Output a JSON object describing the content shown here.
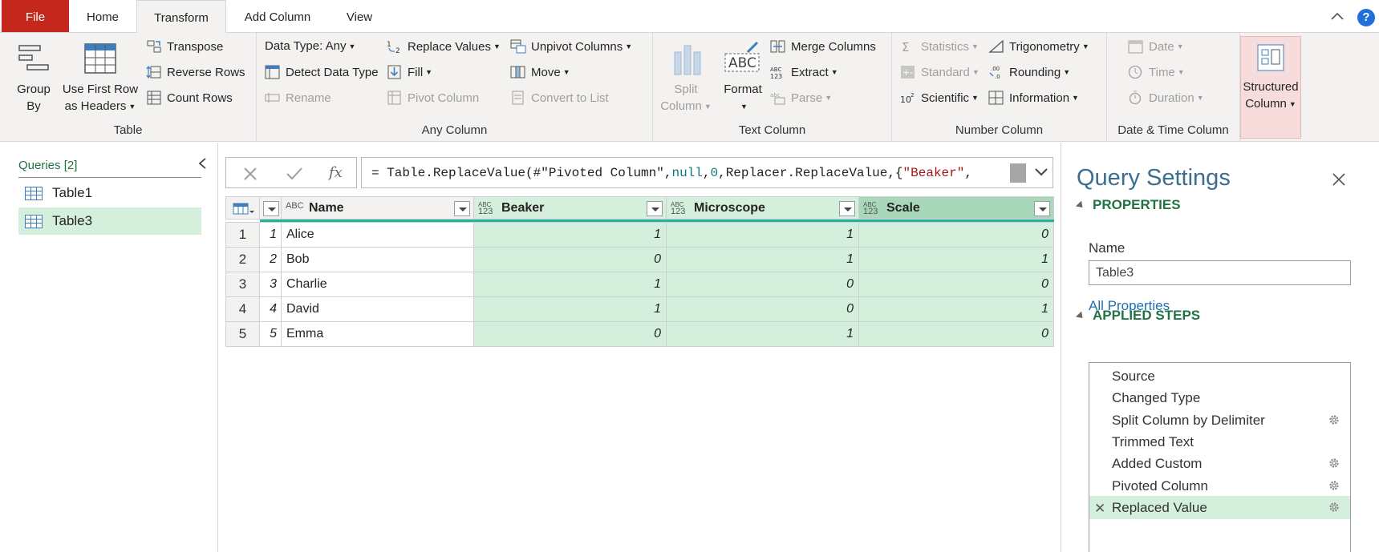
{
  "tabs": {
    "file": "File",
    "home": "Home",
    "transform": "Transform",
    "add_column": "Add Column",
    "view": "View"
  },
  "help_glyph": "?",
  "ribbon": {
    "table_group": {
      "label": "Table",
      "group_by": [
        "Group",
        "By"
      ],
      "use_first_row": [
        "Use First Row",
        "as Headers"
      ],
      "transpose": "Transpose",
      "reverse_rows": "Reverse Rows",
      "count_rows": "Count Rows"
    },
    "any_column_group": {
      "label": "Any Column",
      "data_type": "Data Type: Any",
      "detect_data_type": "Detect Data Type",
      "rename": "Rename",
      "replace_values": "Replace Values",
      "fill": "Fill",
      "pivot_column": "Pivot Column",
      "unpivot_columns": "Unpivot Columns",
      "move": "Move",
      "convert_to_list": "Convert to List"
    },
    "text_column_group": {
      "label": "Text Column",
      "split_column": [
        "Split",
        "Column"
      ],
      "format": "Format",
      "merge_columns": "Merge Columns",
      "extract": "Extract",
      "parse": "Parse"
    },
    "number_column_group": {
      "label": "Number Column",
      "statistics": "Statistics",
      "standard": "Standard",
      "scientific": "Scientific",
      "trigonometry": "Trigonometry",
      "rounding": "Rounding",
      "information": "Information"
    },
    "date_time_group": {
      "label": "Date & Time Column",
      "date": "Date",
      "time": "Time",
      "duration": "Duration"
    },
    "structured_group": {
      "structured_column": [
        "Structured",
        "Column"
      ]
    }
  },
  "queries": {
    "header": "Queries [2]",
    "items": [
      {
        "label": "Table1",
        "selected": false
      },
      {
        "label": "Table3",
        "selected": true
      }
    ]
  },
  "formula_bar": {
    "fx": "fx",
    "parts": [
      {
        "text": "= Table.ReplaceValue(#\"Pivoted Column\",",
        "color": "#222222"
      },
      {
        "text": "null",
        "color": "#0e7a7a"
      },
      {
        "text": ",",
        "color": "#222222"
      },
      {
        "text": "0",
        "color": "#0e7a7a"
      },
      {
        "text": ",Replacer.ReplaceValue,{",
        "color": "#222222"
      },
      {
        "text": "\"Beaker\"",
        "color": "#a31515"
      },
      {
        "text": ",",
        "color": "#222222"
      }
    ]
  },
  "grid": {
    "type_labels": {
      "text": "ABC",
      "any_top": "ABC",
      "any_bottom": "123"
    },
    "columns": [
      "Name",
      "Beaker",
      "Microscope",
      "Scale"
    ],
    "rows": [
      {
        "n": "1",
        "idx": "1",
        "name": "Alice",
        "beaker": "1",
        "microscope": "1",
        "scale": "0"
      },
      {
        "n": "2",
        "idx": "2",
        "name": "Bob",
        "beaker": "0",
        "microscope": "1",
        "scale": "1"
      },
      {
        "n": "3",
        "idx": "3",
        "name": "Charlie",
        "beaker": "1",
        "microscope": "0",
        "scale": "0"
      },
      {
        "n": "4",
        "idx": "4",
        "name": "David",
        "beaker": "1",
        "microscope": "0",
        "scale": "1"
      },
      {
        "n": "5",
        "idx": "5",
        "name": "Emma",
        "beaker": "0",
        "microscope": "1",
        "scale": "0"
      }
    ]
  },
  "query_settings": {
    "title": "Query Settings",
    "properties_header": "PROPERTIES",
    "name_label": "Name",
    "name_value": "Table3",
    "all_properties": "All Properties",
    "applied_steps_header": "APPLIED STEPS",
    "steps": [
      {
        "label": "Source",
        "gear": false,
        "selected": false
      },
      {
        "label": "Changed Type",
        "gear": false,
        "selected": false
      },
      {
        "label": "Split Column by Delimiter",
        "gear": true,
        "selected": false
      },
      {
        "label": "Trimmed Text",
        "gear": false,
        "selected": false
      },
      {
        "label": "Added Custom",
        "gear": true,
        "selected": false
      },
      {
        "label": "Pivoted Column",
        "gear": true,
        "selected": false
      },
      {
        "label": "Replaced Value",
        "gear": true,
        "selected": true
      }
    ]
  },
  "colors": {
    "file_tab": "#c4271b",
    "accent_green": "#217346",
    "selected_fill": "#d4efdc",
    "column_quality_bar": "#21b5a0",
    "link_blue": "#1f6fb5"
  }
}
